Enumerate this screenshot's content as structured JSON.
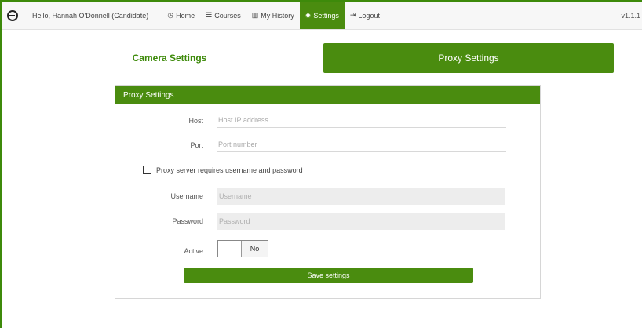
{
  "nav": {
    "greeting": "Hello, Hannah O'Donnell (Candidate)",
    "items": [
      {
        "icon": "home-icon",
        "glyph": "◷",
        "label": "Home"
      },
      {
        "icon": "courses-icon",
        "glyph": "☰",
        "label": "Courses"
      },
      {
        "icon": "history-icon",
        "glyph": "▥",
        "label": "My History"
      },
      {
        "icon": "gear-icon",
        "glyph": "✹",
        "label": "Settings"
      },
      {
        "icon": "logout-icon",
        "glyph": "⇥",
        "label": "Logout"
      }
    ],
    "active": "Settings",
    "version": "v1.1.1"
  },
  "tabs": {
    "camera": "Camera Settings",
    "proxy": "Proxy Settings",
    "active": "Proxy Settings"
  },
  "panel": {
    "title": "Proxy Settings",
    "host": {
      "label": "Host",
      "value": "",
      "placeholder": "Host IP address"
    },
    "port": {
      "label": "Port",
      "value": "",
      "placeholder": "Port number"
    },
    "requires_auth": {
      "label": "Proxy server requires username and password",
      "checked": false
    },
    "username": {
      "label": "Username",
      "value": "",
      "placeholder": "Username"
    },
    "password": {
      "label": "Password",
      "value": "",
      "placeholder": "Password"
    },
    "active": {
      "label": "Active",
      "state": "No"
    },
    "save_label": "Save settings"
  },
  "colors": {
    "accent": "#4a8c0f",
    "accent_text": "#3d8a0a"
  }
}
